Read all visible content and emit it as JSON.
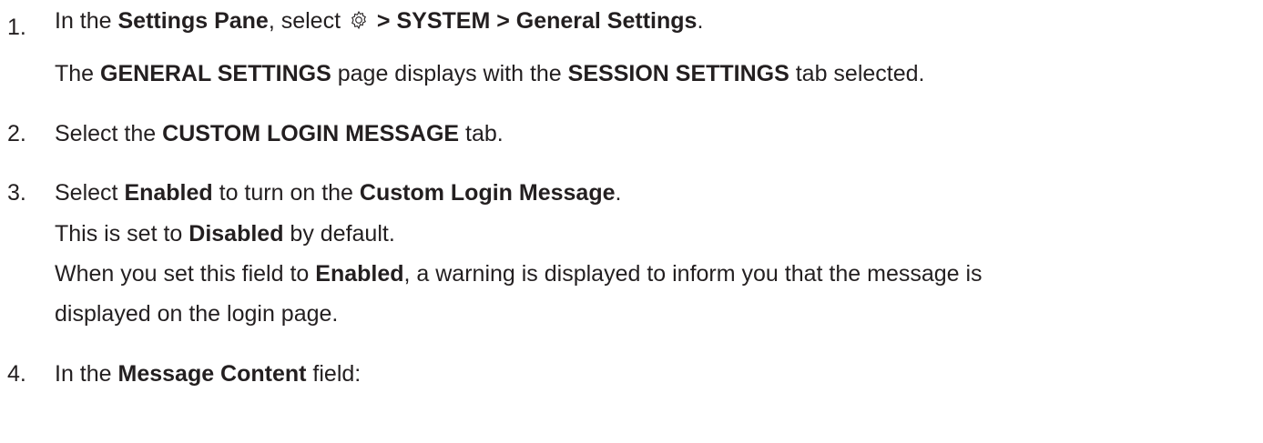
{
  "steps": [
    {
      "number": "1.",
      "parts": [
        "In the ",
        "Settings Pane",
        ", select ",
        " > SYSTEM > General Settings",
        "."
      ],
      "gear_icon": "gear-icon",
      "sub": [
        "The ",
        "GENERAL SETTINGS",
        " page displays with the ",
        "SESSION SETTINGS",
        " tab selected."
      ]
    },
    {
      "number": "2.",
      "parts": [
        "Select the ",
        "CUSTOM LOGIN MESSAGE",
        " tab."
      ]
    },
    {
      "number": "3.",
      "parts": [
        "Select ",
        "Enabled",
        " to turn on the ",
        "Custom Login Message",
        "."
      ],
      "sub1": [
        "This is set to ",
        "Disabled",
        " by default."
      ],
      "sub2": [
        "When you set this field to ",
        "Enabled",
        ", a warning is displayed to inform you that the message is"
      ],
      "sub3": "displayed on the login page."
    },
    {
      "number": "4.",
      "parts": [
        "In the ",
        "Message Content",
        " field:"
      ]
    }
  ]
}
